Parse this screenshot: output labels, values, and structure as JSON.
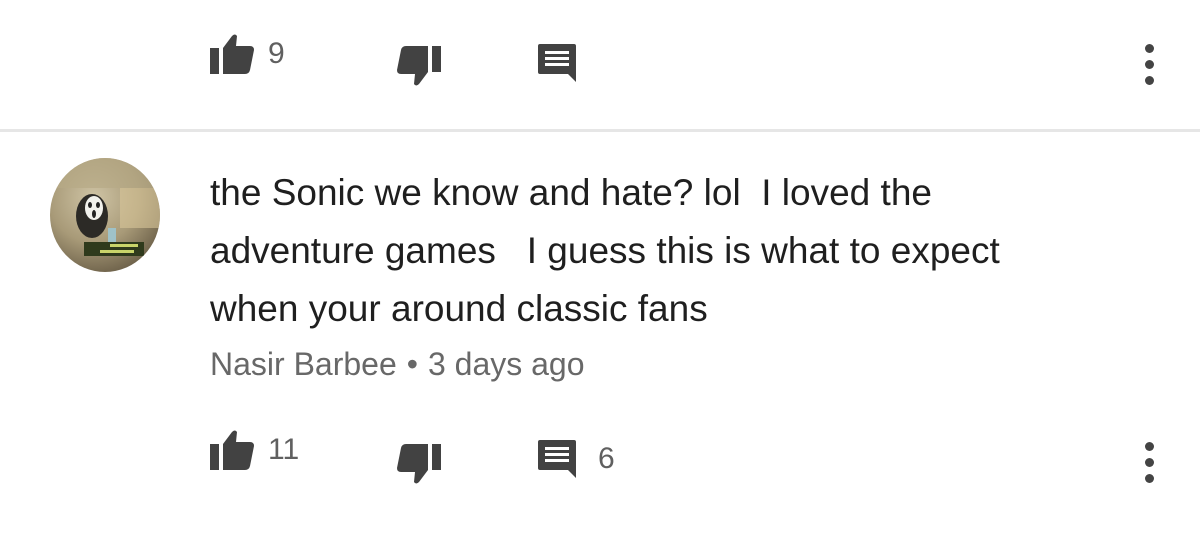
{
  "top_actions": {
    "like_count": "9",
    "dislike_count": "",
    "reply_count": ""
  },
  "comment": {
    "text": "the Sonic we know and hate? lol  I loved the\nadventure games   I guess this is what to expect\nwhen your around classic fans",
    "author": "Nasir Barbee",
    "separator": "•",
    "time": "3 days ago"
  },
  "comment_actions": {
    "like_count": "11",
    "dislike_count": "",
    "reply_count": "6"
  },
  "icons": {
    "like": "thumbs-up-icon",
    "dislike": "thumbs-down-icon",
    "reply": "comment-icon",
    "more": "more-vertical-icon"
  },
  "colors": {
    "icon": "#424242",
    "count": "#606060",
    "divider": "#e6e6e6"
  }
}
